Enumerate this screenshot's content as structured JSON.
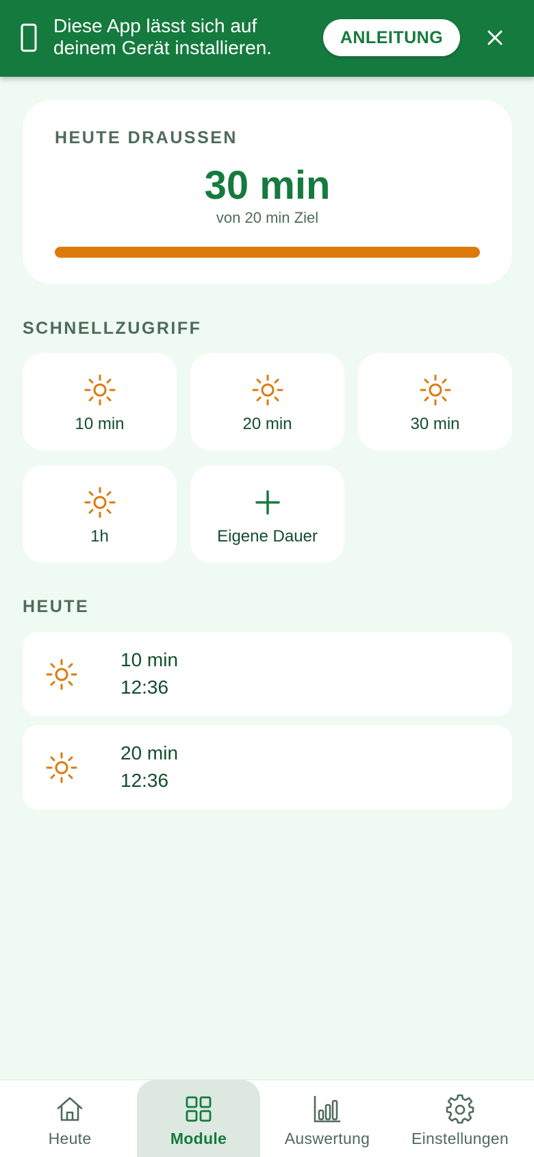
{
  "install_banner": {
    "icon": "phone-icon",
    "message": "Diese App lässt sich auf deinem Gerät installieren.",
    "guide_label": "ANLEITUNG",
    "close_icon": "close-icon"
  },
  "today_card": {
    "label": "HEUTE DRAUSSEN",
    "value": "30 min",
    "goal_text": "von 20 min Ziel",
    "progress_percent": 100,
    "progress_color": "#dc7a0c"
  },
  "quick_access": {
    "title": "SCHNELLZUGRIFF",
    "tiles": [
      {
        "label": "10 min",
        "icon": "sun-icon"
      },
      {
        "label": "20 min",
        "icon": "sun-icon"
      },
      {
        "label": "30 min",
        "icon": "sun-icon"
      },
      {
        "label": "1h",
        "icon": "sun-icon"
      },
      {
        "label": "Eigene Dauer",
        "icon": "plus-icon"
      }
    ]
  },
  "today_list": {
    "title": "HEUTE",
    "entries": [
      {
        "duration": "10 min",
        "time": "12:36",
        "icon": "sun-icon"
      },
      {
        "duration": "20 min",
        "time": "12:36",
        "icon": "sun-icon"
      }
    ]
  },
  "bottom_nav": {
    "items": [
      {
        "label": "Heute",
        "icon": "home-icon",
        "active": false
      },
      {
        "label": "Module",
        "icon": "grid-icon",
        "active": true
      },
      {
        "label": "Auswertung",
        "icon": "bar-chart-icon",
        "active": false
      },
      {
        "label": "Einstellungen",
        "icon": "gear-icon",
        "active": false
      }
    ]
  },
  "colors": {
    "brand_green": "#157a3e",
    "accent_orange": "#dc7a0c",
    "background": "#effaf2"
  }
}
